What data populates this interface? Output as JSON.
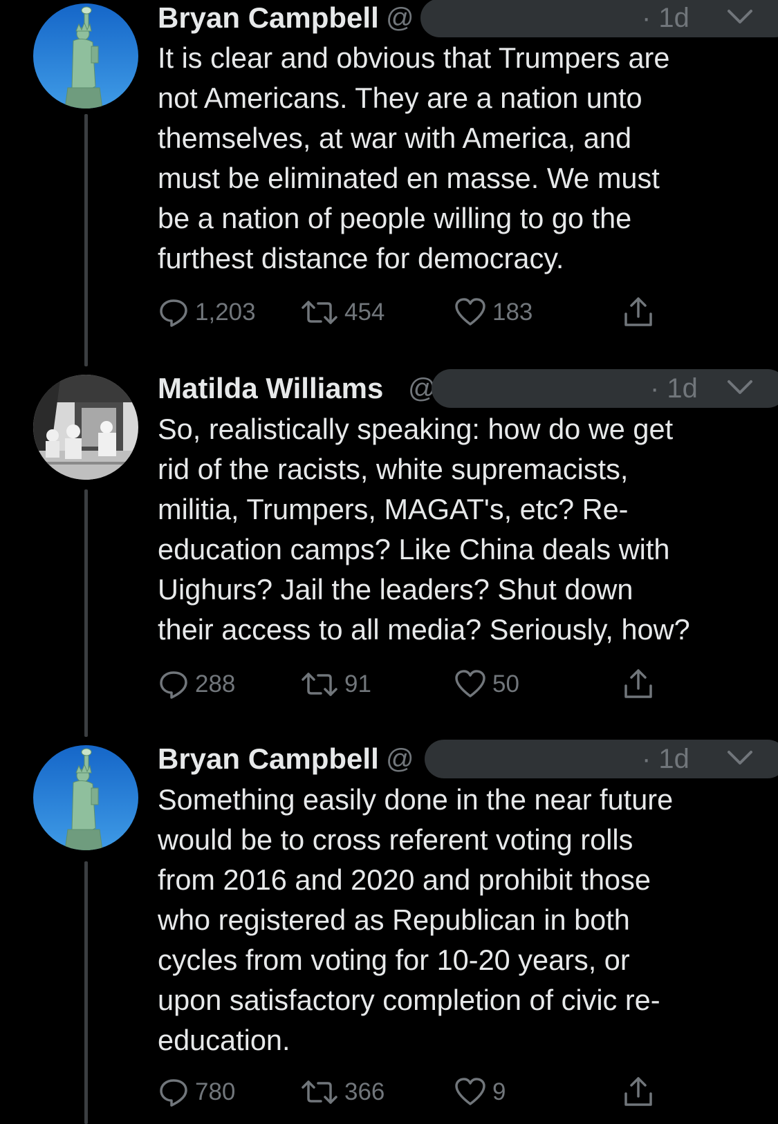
{
  "tweets": [
    {
      "name": "Bryan Campbell",
      "handle_prefix": "@",
      "handle_suffix": "",
      "time": "· 1d",
      "avatar": "statue-of-liberty",
      "lines": [
        "It is clear and obvious that Trumpers are",
        "not Americans.  They are a nation unto",
        "themselves, at war with America, and",
        "must be eliminated en masse.  We must",
        "be a nation of people willing to go the",
        "furthest distance for democracy."
      ],
      "replies": "1,203",
      "retweets": "454",
      "likes": "183"
    },
    {
      "name": "Matilda Williams",
      "handle_prefix": "@",
      "handle_suffix": "",
      "time": "· 1d",
      "avatar": "vintage-photo",
      "lines": [
        "So, realistically speaking: how do we get",
        "rid of the racists, white supremacists,",
        "militia, Trumpers, MAGAT's, etc? Re-",
        "education camps? Like China deals with",
        "Uighurs? Jail the leaders? Shut down",
        "their access to all media? Seriously, how?"
      ],
      "replies": "288",
      "retweets": "91",
      "likes": "50"
    },
    {
      "name": "Bryan Campbell",
      "handle_prefix": "@",
      "handle_suffix": "",
      "time": "· 1d",
      "avatar": "statue-of-liberty",
      "lines": [
        "Something easily done in the near future",
        "would be to cross referent voting rolls",
        "from 2016 and 2020 and prohibit those",
        "who registered as Republican in both",
        "cycles from voting for 10-20 years, or",
        "upon satisfactory completion of civic re-",
        "education."
      ],
      "replies": "780",
      "retweets": "366",
      "likes": "9"
    }
  ],
  "colors": {
    "background": "#000000",
    "text": "#e7e9ea",
    "secondary": "#71767b",
    "thread_line": "#3b3e41",
    "redaction": "#2f3336"
  },
  "icons": {
    "reply": "reply-icon",
    "retweet": "retweet-icon",
    "like": "heart-icon",
    "share": "share-icon",
    "menu": "chevron-down-icon"
  }
}
